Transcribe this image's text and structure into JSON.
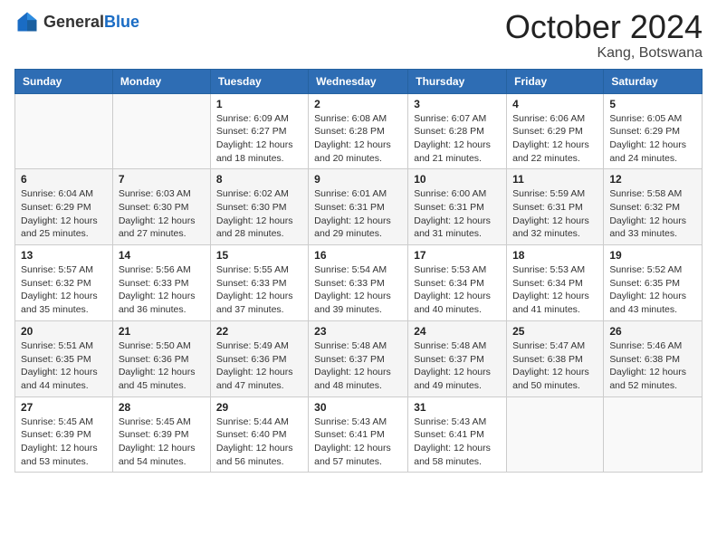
{
  "header": {
    "logo_general": "General",
    "logo_blue": "Blue",
    "month_title": "October 2024",
    "location": "Kang, Botswana"
  },
  "days_of_week": [
    "Sunday",
    "Monday",
    "Tuesday",
    "Wednesday",
    "Thursday",
    "Friday",
    "Saturday"
  ],
  "weeks": [
    [
      {
        "day": "",
        "info": ""
      },
      {
        "day": "",
        "info": ""
      },
      {
        "day": "1",
        "info": "Sunrise: 6:09 AM\nSunset: 6:27 PM\nDaylight: 12 hours and 18 minutes."
      },
      {
        "day": "2",
        "info": "Sunrise: 6:08 AM\nSunset: 6:28 PM\nDaylight: 12 hours and 20 minutes."
      },
      {
        "day": "3",
        "info": "Sunrise: 6:07 AM\nSunset: 6:28 PM\nDaylight: 12 hours and 21 minutes."
      },
      {
        "day": "4",
        "info": "Sunrise: 6:06 AM\nSunset: 6:29 PM\nDaylight: 12 hours and 22 minutes."
      },
      {
        "day": "5",
        "info": "Sunrise: 6:05 AM\nSunset: 6:29 PM\nDaylight: 12 hours and 24 minutes."
      }
    ],
    [
      {
        "day": "6",
        "info": "Sunrise: 6:04 AM\nSunset: 6:29 PM\nDaylight: 12 hours and 25 minutes."
      },
      {
        "day": "7",
        "info": "Sunrise: 6:03 AM\nSunset: 6:30 PM\nDaylight: 12 hours and 27 minutes."
      },
      {
        "day": "8",
        "info": "Sunrise: 6:02 AM\nSunset: 6:30 PM\nDaylight: 12 hours and 28 minutes."
      },
      {
        "day": "9",
        "info": "Sunrise: 6:01 AM\nSunset: 6:31 PM\nDaylight: 12 hours and 29 minutes."
      },
      {
        "day": "10",
        "info": "Sunrise: 6:00 AM\nSunset: 6:31 PM\nDaylight: 12 hours and 31 minutes."
      },
      {
        "day": "11",
        "info": "Sunrise: 5:59 AM\nSunset: 6:31 PM\nDaylight: 12 hours and 32 minutes."
      },
      {
        "day": "12",
        "info": "Sunrise: 5:58 AM\nSunset: 6:32 PM\nDaylight: 12 hours and 33 minutes."
      }
    ],
    [
      {
        "day": "13",
        "info": "Sunrise: 5:57 AM\nSunset: 6:32 PM\nDaylight: 12 hours and 35 minutes."
      },
      {
        "day": "14",
        "info": "Sunrise: 5:56 AM\nSunset: 6:33 PM\nDaylight: 12 hours and 36 minutes."
      },
      {
        "day": "15",
        "info": "Sunrise: 5:55 AM\nSunset: 6:33 PM\nDaylight: 12 hours and 37 minutes."
      },
      {
        "day": "16",
        "info": "Sunrise: 5:54 AM\nSunset: 6:33 PM\nDaylight: 12 hours and 39 minutes."
      },
      {
        "day": "17",
        "info": "Sunrise: 5:53 AM\nSunset: 6:34 PM\nDaylight: 12 hours and 40 minutes."
      },
      {
        "day": "18",
        "info": "Sunrise: 5:53 AM\nSunset: 6:34 PM\nDaylight: 12 hours and 41 minutes."
      },
      {
        "day": "19",
        "info": "Sunrise: 5:52 AM\nSunset: 6:35 PM\nDaylight: 12 hours and 43 minutes."
      }
    ],
    [
      {
        "day": "20",
        "info": "Sunrise: 5:51 AM\nSunset: 6:35 PM\nDaylight: 12 hours and 44 minutes."
      },
      {
        "day": "21",
        "info": "Sunrise: 5:50 AM\nSunset: 6:36 PM\nDaylight: 12 hours and 45 minutes."
      },
      {
        "day": "22",
        "info": "Sunrise: 5:49 AM\nSunset: 6:36 PM\nDaylight: 12 hours and 47 minutes."
      },
      {
        "day": "23",
        "info": "Sunrise: 5:48 AM\nSunset: 6:37 PM\nDaylight: 12 hours and 48 minutes."
      },
      {
        "day": "24",
        "info": "Sunrise: 5:48 AM\nSunset: 6:37 PM\nDaylight: 12 hours and 49 minutes."
      },
      {
        "day": "25",
        "info": "Sunrise: 5:47 AM\nSunset: 6:38 PM\nDaylight: 12 hours and 50 minutes."
      },
      {
        "day": "26",
        "info": "Sunrise: 5:46 AM\nSunset: 6:38 PM\nDaylight: 12 hours and 52 minutes."
      }
    ],
    [
      {
        "day": "27",
        "info": "Sunrise: 5:45 AM\nSunset: 6:39 PM\nDaylight: 12 hours and 53 minutes."
      },
      {
        "day": "28",
        "info": "Sunrise: 5:45 AM\nSunset: 6:39 PM\nDaylight: 12 hours and 54 minutes."
      },
      {
        "day": "29",
        "info": "Sunrise: 5:44 AM\nSunset: 6:40 PM\nDaylight: 12 hours and 56 minutes."
      },
      {
        "day": "30",
        "info": "Sunrise: 5:43 AM\nSunset: 6:41 PM\nDaylight: 12 hours and 57 minutes."
      },
      {
        "day": "31",
        "info": "Sunrise: 5:43 AM\nSunset: 6:41 PM\nDaylight: 12 hours and 58 minutes."
      },
      {
        "day": "",
        "info": ""
      },
      {
        "day": "",
        "info": ""
      }
    ]
  ]
}
